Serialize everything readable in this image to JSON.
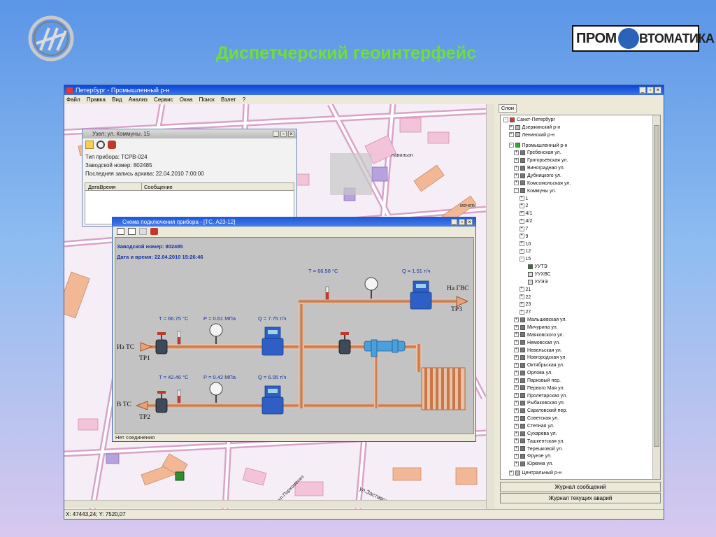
{
  "slide": {
    "title": "Диспетчерский геоинтерфейс",
    "logo_right_parts": [
      "ПРОМ",
      "ВТОМАТИКА"
    ]
  },
  "app": {
    "title": "Петербург - Промышленный р-н",
    "menu": [
      "Файл",
      "Правка",
      "Вид",
      "Анализ",
      "Сервис",
      "Окна",
      "Поиск",
      "Взлет",
      "?"
    ],
    "status": "X: 47443,24; Y: 7520,07"
  },
  "map_labels": {
    "pavilion": "павильон",
    "street_a": "мечеть",
    "street_b": "ул.Пархоменко",
    "street_c": "ул.Заставская"
  },
  "node_window": {
    "title": "Узел: ул. Коммуны, 15",
    "device_type": "Тип прибора: ТСРВ-024",
    "serial": "Заводской номер: 802485",
    "last_record": "Последняя запись архива: 22.04.2010 7:00:00",
    "columns": [
      "ДатаВремя",
      "Сообщение"
    ]
  },
  "scheme_window": {
    "title": "Схема подключения прибора - [ТС, А23-12]",
    "serial": "Заводской номер: 802485",
    "datetime": "Дата и время: 22.04.2010 15:26:46",
    "status": "Нет соединения",
    "tp1": {
      "in_label": "Из ТС",
      "name": "ТР1",
      "T": "Т = 66.75 °С",
      "P": "Р = 0.61 МПа",
      "Q": "Q = 7.75 т/ч"
    },
    "tp2": {
      "out_label": "В ТС",
      "name": "ТР2",
      "T": "Т = 42.46 °С",
      "P": "Р = 0.42 МПа",
      "Q": "Q = 6.05 т/ч"
    },
    "tp3": {
      "out_label": "На ГВС",
      "name": "ТР3",
      "T": "Т = 66.58 °С",
      "Q": "Q = 1.51 т/ч"
    }
  },
  "layers": {
    "tab": "Слои",
    "root": "Санкт-Петербург",
    "districts_top": [
      "Дзержинский р-н",
      "Ленинский р-н",
      "Промышленный р-н"
    ],
    "streets_a": [
      "Гребенская ул.",
      "Григорьевская ул.",
      "Виноградная ул.",
      "Дубницкого ул.",
      "Комсомольская ул.",
      "Коммуны ул."
    ],
    "houses": [
      "1",
      "2",
      "4/1",
      "4/2",
      "7",
      "9",
      "10",
      "12",
      "15"
    ],
    "house15_children": [
      "УУТЭ",
      "УУХВС",
      "УУЭЭ"
    ],
    "houses_after": [
      "21",
      "22",
      "23",
      "27"
    ],
    "streets_b": [
      "Мальшевская ул.",
      "Мичурина ул.",
      "Маяковского ул.",
      "Немовская ул.",
      "Невельская ул.",
      "Новгородская ул.",
      "Октябрьская ул.",
      "Орлова ул.",
      "Парковый пер.",
      "Первого Мая ул.",
      "Пролетарская ул.",
      "Рыбаковская ул.",
      "Саратовский пер.",
      "Советская ул.",
      "Степная ул.",
      "Сухарева ул.",
      "Ташкентская ул.",
      "Терешковой ул.",
      "Фрунзе ул.",
      "Юркина ул."
    ],
    "district_last": "Центральный р-н",
    "btn_messages": "Журнал сообщений",
    "btn_alarms": "Журнал текущих аварий"
  }
}
